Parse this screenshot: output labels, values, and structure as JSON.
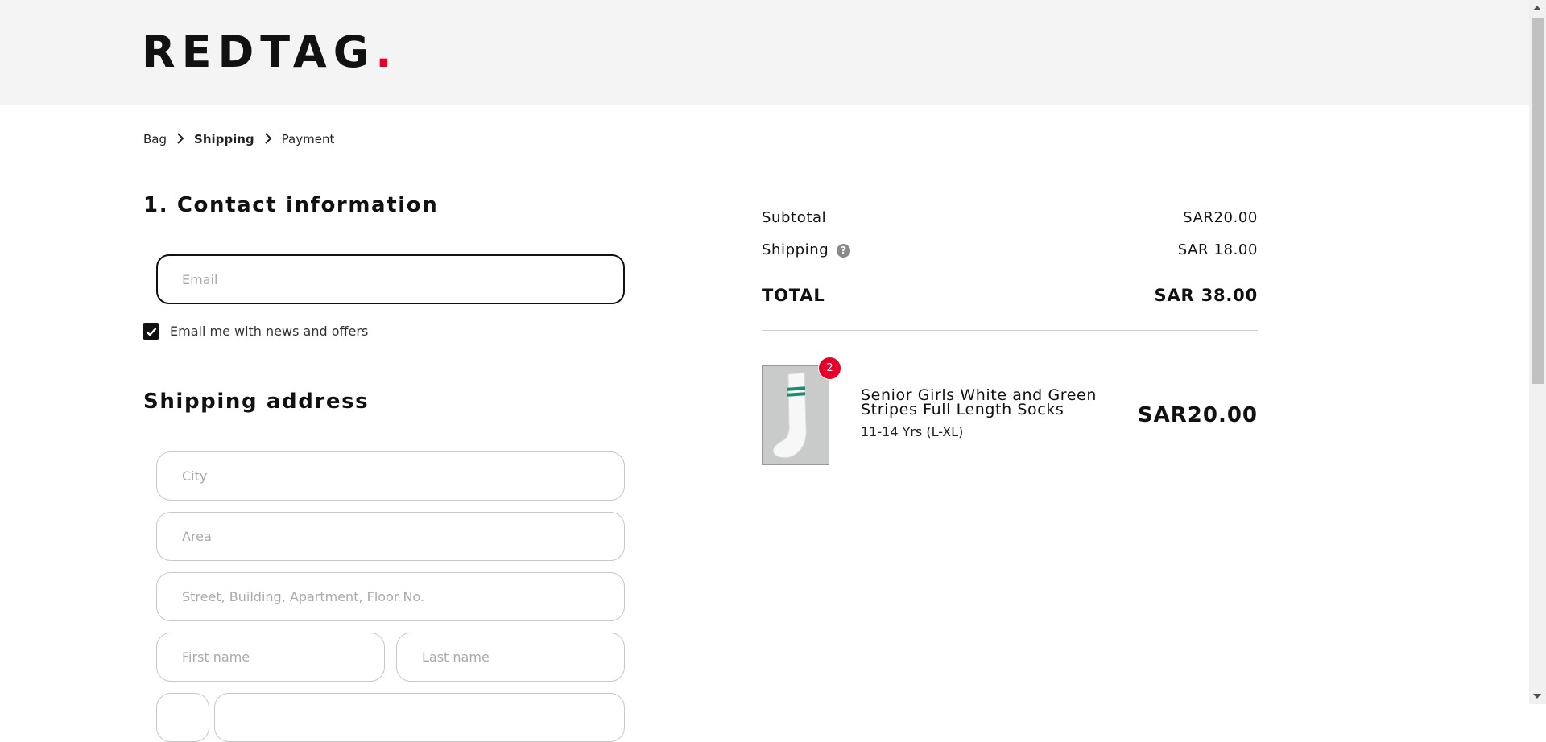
{
  "brand": {
    "name": "REDTAG",
    "dot": "."
  },
  "breadcrumb": {
    "items": [
      "Bag",
      "Shipping",
      "Payment"
    ],
    "active": "Shipping"
  },
  "contact": {
    "title": "1. Contact information",
    "email_placeholder": "Email",
    "email_value": "",
    "newsletter_checked": true,
    "newsletter_label": "Email me with news and offers"
  },
  "shipping": {
    "title": "Shipping address",
    "city_placeholder": "City",
    "area_placeholder": "Area",
    "street_placeholder": "Street, Building, Apartment, Floor No.",
    "first_name_placeholder": "First name",
    "last_name_placeholder": "Last name"
  },
  "summary": {
    "subtotal_label": "Subtotal",
    "subtotal_value": "SAR20.00",
    "shipping_label": "Shipping",
    "shipping_value": "SAR 18.00",
    "total_label": "TOTAL",
    "total_value": "SAR 38.00",
    "help_icon": "question-icon"
  },
  "cart_item": {
    "quantity": "2",
    "name": "Senior Girls White and Green Stripes Full Length Socks",
    "variant": "11-14 Yrs (L-XL)",
    "price": "SAR20.00"
  },
  "colors": {
    "accent": "#e4002b",
    "header_bg": "#f4f4f4",
    "text": "#111111",
    "sock_stripe": "#1e8a6e"
  }
}
